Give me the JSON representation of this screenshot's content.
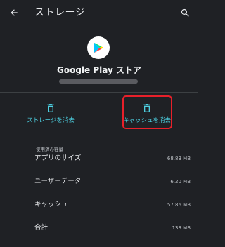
{
  "appbar": {
    "title": "ストレージ",
    "back_icon": "arrow-back-icon",
    "search_icon": "search-icon"
  },
  "app": {
    "name": "Google Play ストア",
    "icon": "google-play-icon"
  },
  "actions": [
    {
      "label": "ストレージを消去",
      "icon": "trash-icon"
    },
    {
      "label": "キャッシュを消去",
      "icon": "trash-icon"
    }
  ],
  "usage": {
    "section_title": "使用済み容量",
    "rows": [
      {
        "label": "アプリのサイズ",
        "value": "68.83 MB"
      },
      {
        "label": "ユーザーデータ",
        "value": "6.20 MB"
      },
      {
        "label": "キャッシュ",
        "value": "57.86 MB"
      },
      {
        "label": "合計",
        "value": "133 MB"
      }
    ]
  },
  "colors": {
    "background": "#1f2125",
    "accent": "#4dd0e1",
    "highlight": "#e8202a",
    "divider": "#3c4043"
  }
}
